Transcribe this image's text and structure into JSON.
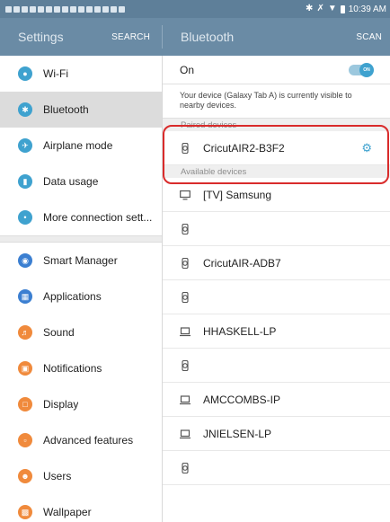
{
  "status_bar": {
    "time": "10:39 AM",
    "notification_count": 15,
    "icons": [
      "bluetooth-icon",
      "mute-icon",
      "wifi-icon",
      "battery-icon"
    ]
  },
  "settings_header": {
    "title": "Settings",
    "search_label": "SEARCH"
  },
  "bluetooth_header": {
    "title": "Bluetooth",
    "scan_label": "SCAN"
  },
  "sidebar": {
    "items": [
      {
        "label": "Wi-Fi",
        "icon": "wifi-icon",
        "color": "#3fa2cf",
        "selected": false
      },
      {
        "label": "Bluetooth",
        "icon": "bluetooth-icon",
        "color": "#3fa2cf",
        "selected": true
      },
      {
        "label": "Airplane mode",
        "icon": "airplane-icon",
        "color": "#3fa2cf",
        "selected": false
      },
      {
        "label": "Data usage",
        "icon": "data-usage-icon",
        "color": "#3fa2cf",
        "selected": false
      },
      {
        "label": "More connection sett...",
        "icon": "more-connections-icon",
        "color": "#3fa2cf",
        "selected": false
      },
      {
        "label": "Smart Manager",
        "icon": "smart-manager-icon",
        "color": "#3b7fd1",
        "selected": false
      },
      {
        "label": "Applications",
        "icon": "applications-icon",
        "color": "#3b7fd1",
        "selected": false
      },
      {
        "label": "Sound",
        "icon": "sound-icon",
        "color": "#f08a3c",
        "selected": false
      },
      {
        "label": "Notifications",
        "icon": "notifications-icon",
        "color": "#f08a3c",
        "selected": false
      },
      {
        "label": "Display",
        "icon": "display-icon",
        "color": "#f08a3c",
        "selected": false
      },
      {
        "label": "Advanced features",
        "icon": "advanced-features-icon",
        "color": "#f08a3c",
        "selected": false
      },
      {
        "label": "Users",
        "icon": "users-icon",
        "color": "#f08a3c",
        "selected": false
      },
      {
        "label": "Wallpaper",
        "icon": "wallpaper-icon",
        "color": "#f08a3c",
        "selected": false
      }
    ]
  },
  "bluetooth": {
    "state_label": "On",
    "toggle_label": "ON",
    "toggle_on": true,
    "visibility_note": "Your device (Galaxy Tab A) is currently visible to nearby devices.",
    "paired_header": "Paired devices",
    "paired": [
      {
        "name": "CricutAIR2-B3F2",
        "icon": "watch-icon"
      }
    ],
    "available_header": "Available devices",
    "available": [
      {
        "name": "[TV] Samsung",
        "icon": "tv-icon"
      },
      {
        "name": "",
        "icon": "watch-icon"
      },
      {
        "name": "CricutAIR-ADB7",
        "icon": "watch-icon"
      },
      {
        "name": "",
        "icon": "watch-icon"
      },
      {
        "name": "HHASKELL-LP",
        "icon": "laptop-icon"
      },
      {
        "name": "",
        "icon": "watch-icon"
      },
      {
        "name": "AMCCOMBS-IP",
        "icon": "laptop-icon"
      },
      {
        "name": "JNIELSEN-LP",
        "icon": "laptop-icon"
      },
      {
        "name": "",
        "icon": "watch-icon"
      }
    ]
  },
  "colors": {
    "accent": "#3fa2cf",
    "header": "#6a8ba5",
    "annotation": "#d92b2b"
  }
}
